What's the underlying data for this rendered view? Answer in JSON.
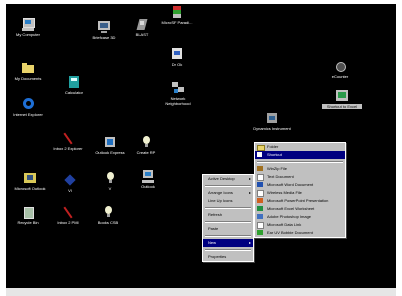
{
  "desktop": {
    "icons": [
      {
        "label": "My Computer"
      },
      {
        "label": "Briefcase 3D"
      },
      {
        "label": "BLAST"
      },
      {
        "label": "MicroSF Paradi..."
      },
      {
        "label": "Dr Ok"
      },
      {
        "label": "Network Neighborhood"
      },
      {
        "label": "Calculator"
      },
      {
        "label": "Internet Explorer"
      },
      {
        "label": "My Documents"
      },
      {
        "label": "eCounter"
      },
      {
        "label": "Shortcut to Excel"
      },
      {
        "label": "Dynamics Instrument"
      },
      {
        "label": "Inbox 2 Explorer"
      },
      {
        "label": "Outlook Express"
      },
      {
        "label": "Create RP"
      },
      {
        "label": "Microsoft Outlook"
      },
      {
        "label": "VI"
      },
      {
        "label": "V"
      },
      {
        "label": "Outlook"
      },
      {
        "label": "Recycle Bin"
      },
      {
        "label": "Inbox 2 PMI"
      },
      {
        "label": "Books CSB"
      }
    ]
  },
  "context_menu": {
    "items": [
      {
        "label": "Active Desktop"
      },
      {
        "label": "Arrange Icons"
      },
      {
        "label": "Line Up Icons"
      },
      {
        "label": "Refresh"
      },
      {
        "label": "Paste"
      },
      {
        "label": "New"
      },
      {
        "label": "Properties"
      }
    ]
  },
  "new_submenu": {
    "items": [
      {
        "label": "Folder"
      },
      {
        "label": "Shortcut"
      },
      {
        "label": "WinZip File"
      },
      {
        "label": "Text Document"
      },
      {
        "label": "Microsoft Word Document"
      },
      {
        "label": "Wireless Media File"
      },
      {
        "label": "Microsoft PowerPoint Presentation"
      },
      {
        "label": "Microsoft Excel Worksheet"
      },
      {
        "label": "Adobe Photoshop Image"
      },
      {
        "label": "Microsoft Data Link"
      },
      {
        "label": "Ear UV Bobbie Document"
      }
    ]
  },
  "colors": {
    "desktop": "#000000",
    "menu_bg": "#c0c0c0",
    "highlight": "#000080"
  }
}
